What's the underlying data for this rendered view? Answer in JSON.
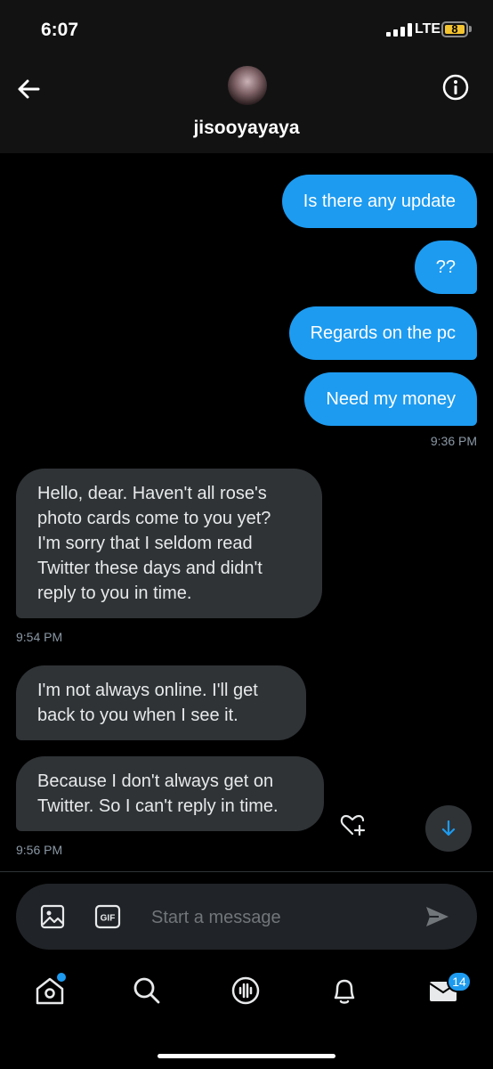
{
  "status_bar": {
    "time": "6:07",
    "network": "LTE",
    "battery": "8"
  },
  "header": {
    "username": "jisooyayaya"
  },
  "messages": {
    "sent": [
      "Is there any update",
      "??",
      "Regards on the pc",
      "Need my money"
    ],
    "sent_time": "9:36 PM",
    "recv1": [
      "Hello, dear. Haven't all rose's",
      "photo cards come to you yet?",
      "I'm sorry that I seldom read",
      "Twitter these days and didn't",
      "reply to you in time."
    ],
    "recv1_time": "9:54 PM",
    "recv2": [
      "I'm not always online. I'll get",
      "back to you when I see it."
    ],
    "recv3": [
      "Because I don't always get on",
      "Twitter. So I can't reply in time."
    ],
    "recv3_time": "9:56 PM"
  },
  "composer": {
    "placeholder": "Start a message",
    "gif_label": "GIF"
  },
  "tabs": {
    "messages_badge": "14"
  },
  "colors": {
    "accent": "#1d9bf0",
    "received_bubble": "#2f3336",
    "background": "#000000"
  }
}
